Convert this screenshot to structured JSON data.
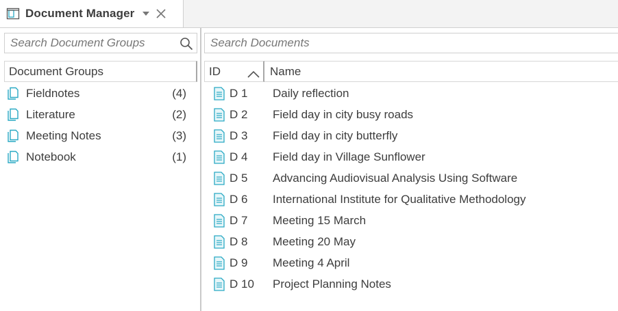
{
  "tab": {
    "title": "Document Manager",
    "icon": "document-manager-icon",
    "menu_icon": "chevron-down-icon",
    "close_icon": "close-icon"
  },
  "groups_pane": {
    "search": {
      "placeholder": "Search Document Groups",
      "value": ""
    },
    "header": "Document Groups",
    "items": [
      {
        "name": "Fieldnotes",
        "count": "(4)"
      },
      {
        "name": "Literature",
        "count": "(2)"
      },
      {
        "name": "Meeting Notes",
        "count": "(3)"
      },
      {
        "name": "Notebook",
        "count": "(1)"
      }
    ]
  },
  "documents_pane": {
    "search": {
      "placeholder": "Search Documents",
      "value": ""
    },
    "columns": {
      "id": "ID",
      "name": "Name"
    },
    "sort": "ascending",
    "rows": [
      {
        "id": "D 1",
        "name": "Daily reflection"
      },
      {
        "id": "D 2",
        "name": "Field day in city busy roads"
      },
      {
        "id": "D 3",
        "name": "Field day in city butterfly"
      },
      {
        "id": "D 4",
        "name": "Field day in Village Sunflower"
      },
      {
        "id": "D 5",
        "name": "Advancing Audiovisual Analysis Using Software"
      },
      {
        "id": "D 6",
        "name": "International Institute for Qualitative Methodology"
      },
      {
        "id": "D 7",
        "name": "Meeting 15 March"
      },
      {
        "id": "D 8",
        "name": "Meeting 20 May"
      },
      {
        "id": "D 9",
        "name": "Meeting 4 April"
      },
      {
        "id": "D 10",
        "name": "Project Planning Notes"
      }
    ]
  },
  "colors": {
    "icon_accent": "#29a9c4",
    "border": "#cfcfcf",
    "text": "#3d3d3d"
  }
}
